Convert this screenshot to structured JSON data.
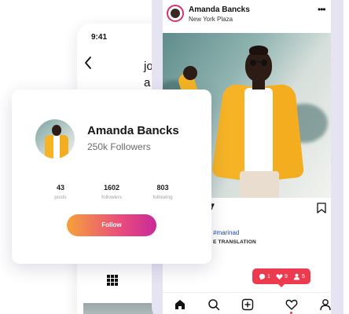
{
  "back_screen": {
    "time": "9:41",
    "title_partial": "jo a"
  },
  "feed": {
    "user_name": "Amanda Bancks",
    "location": "New York Plaza",
    "more": "•••",
    "caption_hashtag": "#marinad",
    "translate_label": "E TRANSLATION",
    "notifications": {
      "comments": "1",
      "likes": "9",
      "followers": "5"
    },
    "colors": {
      "notification": "#ec3a4e",
      "avatar_ring": "#d8326e",
      "hashtag": "#1e4fa8"
    }
  },
  "profile_card": {
    "name": "Amanda Bancks",
    "followers": "250k Followers",
    "stats": [
      {
        "value": "43",
        "label": "posts"
      },
      {
        "value": "1602",
        "label": "followers"
      },
      {
        "value": "803",
        "label": "following"
      }
    ],
    "follow_label": "Follow",
    "button_gradient": [
      "#f5a13a",
      "#ea4c7c",
      "#c82a9a"
    ]
  },
  "icons": {
    "back": "chevron-left-icon",
    "grid": "grid-icon",
    "share": "send-icon",
    "bookmark": "bookmark-icon",
    "nav": [
      "home-icon",
      "search-icon",
      "add-post-icon",
      "heart-icon",
      "profile-icon"
    ]
  }
}
